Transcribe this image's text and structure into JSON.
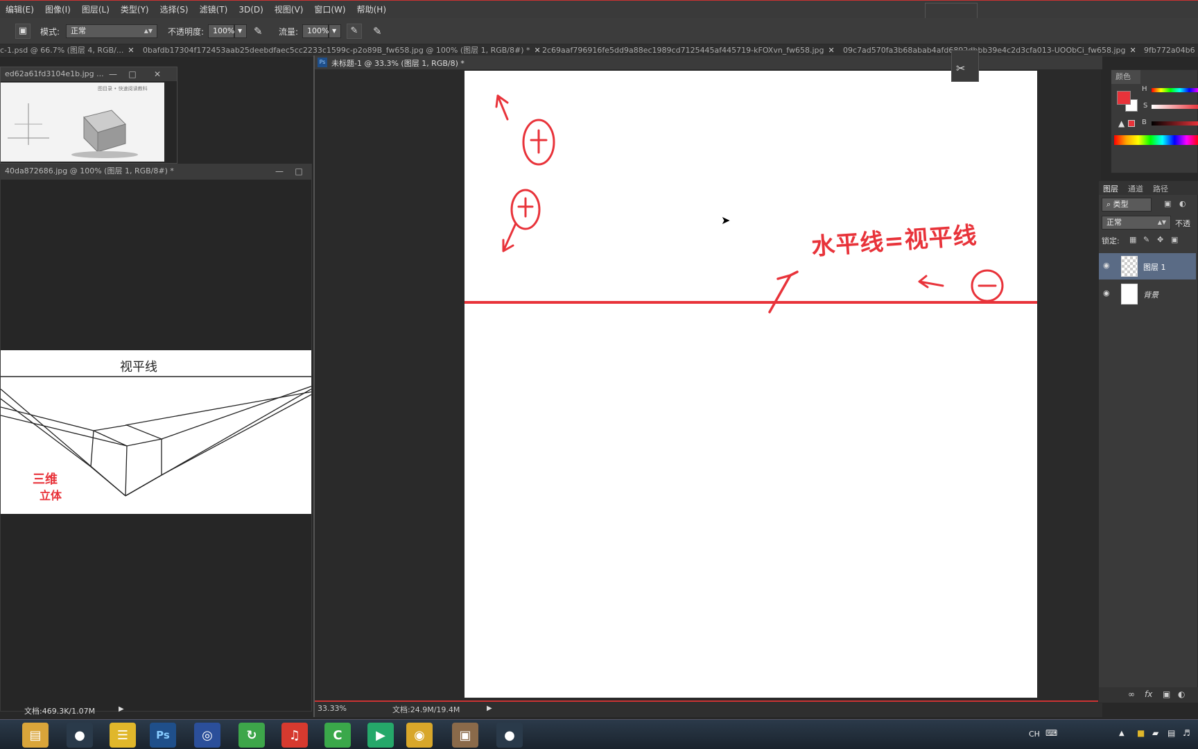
{
  "menu": [
    "编辑(E)",
    "图像(I)",
    "图层(L)",
    "类型(Y)",
    "选择(S)",
    "滤镜(T)",
    "3D(D)",
    "视图(V)",
    "窗口(W)",
    "帮助(H)"
  ],
  "options": {
    "mode_label": "模式:",
    "mode_value": "正常",
    "opacity_label": "不透明度:",
    "opacity_value": "100%",
    "flow_label": "流量:",
    "flow_value": "100%"
  },
  "tabs": [
    "c-1.psd @ 66.7% (图层 4, RGB/...",
    "0bafdb17304f172453aab25deebdfaec5cc2233c1599c-p2o89B_fw658.jpg @ 100% (图层 1, RGB/8#) *",
    "2c69aaf796916fe5dd9a88ec1989cd7125445af445719-kFOXvn_fw658.jpg",
    "09c7ad570fa3b68abab4afd6892dbbb39e4c2d3cfa013-UOObCi_fw658.jpg",
    "9fb772a04b6"
  ],
  "window1": {
    "title": "ed62a61fd3104e1b.jpg ...",
    "thumb_caption": "图目录 • 快速阅读教科"
  },
  "window2": {
    "title": "40da872686.jpg @ 100% (图层 1, RGB/8#) *",
    "horizon_label": "视平线",
    "annotation_line1": "三维",
    "annotation_line2": "立体",
    "status": "文档:469.3K/1.07M"
  },
  "main_doc": {
    "title": "未标题-1 @ 33.3% (图层 1, RGB/8) *",
    "ps_badge": "Ps",
    "zoom": "33.33%",
    "status": "文档:24.9M/19.4M",
    "handwriting": {
      "up_label": "(+)",
      "down_label": "(+)",
      "horizon_text": "水平线=视平线",
      "minus_label": "(−)"
    }
  },
  "color_panel": {
    "title": "颜色",
    "h_label": "H",
    "s_label": "S",
    "b_label": "B",
    "foreground": "#e8333a",
    "background": "#ffffff"
  },
  "layers_panel": {
    "tabs": [
      "图层",
      "通道",
      "路径"
    ],
    "filter": "类型",
    "blend": "正常",
    "opacity_label": "不透",
    "lock_label": "锁定:",
    "layers": [
      {
        "name": "图层 1",
        "selected": true
      },
      {
        "name": "背景",
        "selected": false
      }
    ]
  },
  "taskbar": {
    "tray_lang": "CH",
    "icons": [
      "explorer-icon",
      "qq-icon",
      "notes-icon",
      "photoshop-icon",
      "browser-icon",
      "360-icon",
      "netease-music-icon",
      "camtasia-icon",
      "iqiyi-icon",
      "wechat-icon",
      "photo-icon",
      "qq2-icon"
    ]
  },
  "colors": {
    "accent_red": "#e8333a",
    "ps_blue": "#1f4f8a",
    "selected_layer": "#5a6b85"
  }
}
